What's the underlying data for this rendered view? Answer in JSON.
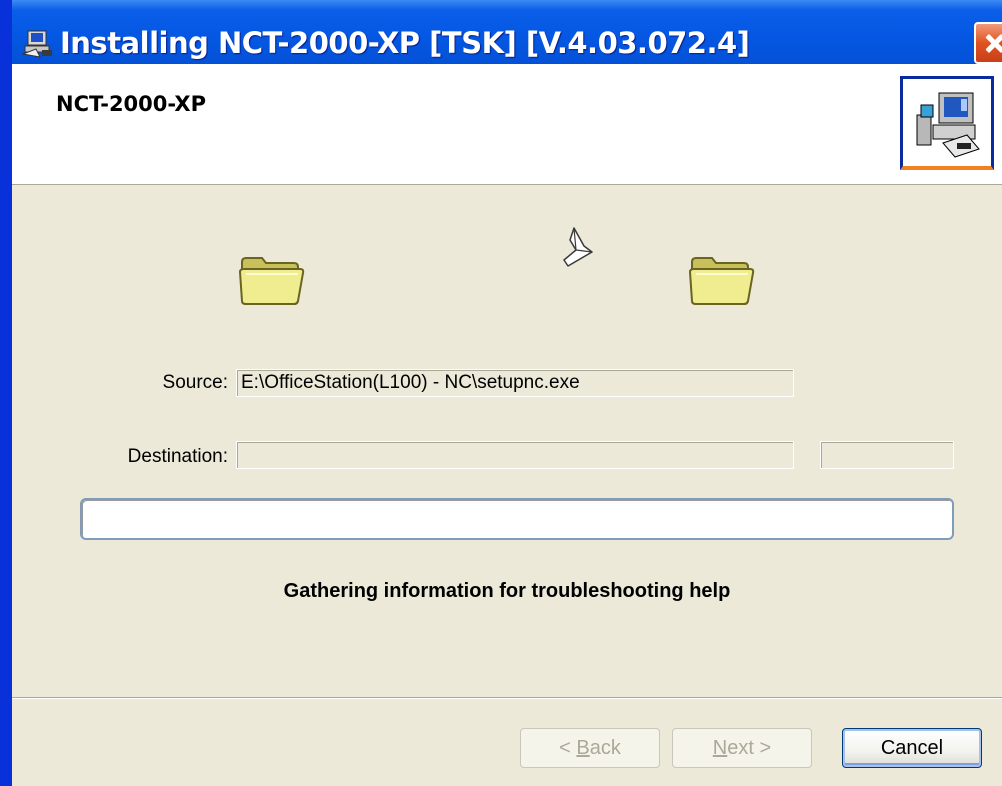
{
  "window": {
    "title": "Installing NCT-2000-XP [TSK] [V.4.03.072.4]",
    "title_icon": "installer-computer-icon",
    "close_icon": "close-icon"
  },
  "banner": {
    "product_name": "NCT-2000-XP",
    "icon": "computer-setup-icon"
  },
  "animation": {
    "source_folder_icon": "folder-icon",
    "flying_paper_icon": "paper-plane-icon",
    "destination_folder_icon": "folder-icon"
  },
  "fields": {
    "source_label": "Source:",
    "source_value": "E:\\OfficeStation(L100) - NC\\setupnc.exe",
    "destination_label": "Destination:",
    "destination_value": "",
    "destination_extra_value": ""
  },
  "progress": {
    "fraction": 0
  },
  "status": {
    "message": "Gathering information for troubleshooting help"
  },
  "buttons": {
    "back": {
      "accel": "B",
      "rest": "ack",
      "prefix": "< "
    },
    "next": {
      "accel": "N",
      "rest": "ext",
      "suffix": " >"
    },
    "cancel": "Cancel"
  },
  "colors": {
    "titlebar": "#0558e3",
    "dialog_bg": "#ece9d8",
    "close_button": "#e0531f"
  }
}
